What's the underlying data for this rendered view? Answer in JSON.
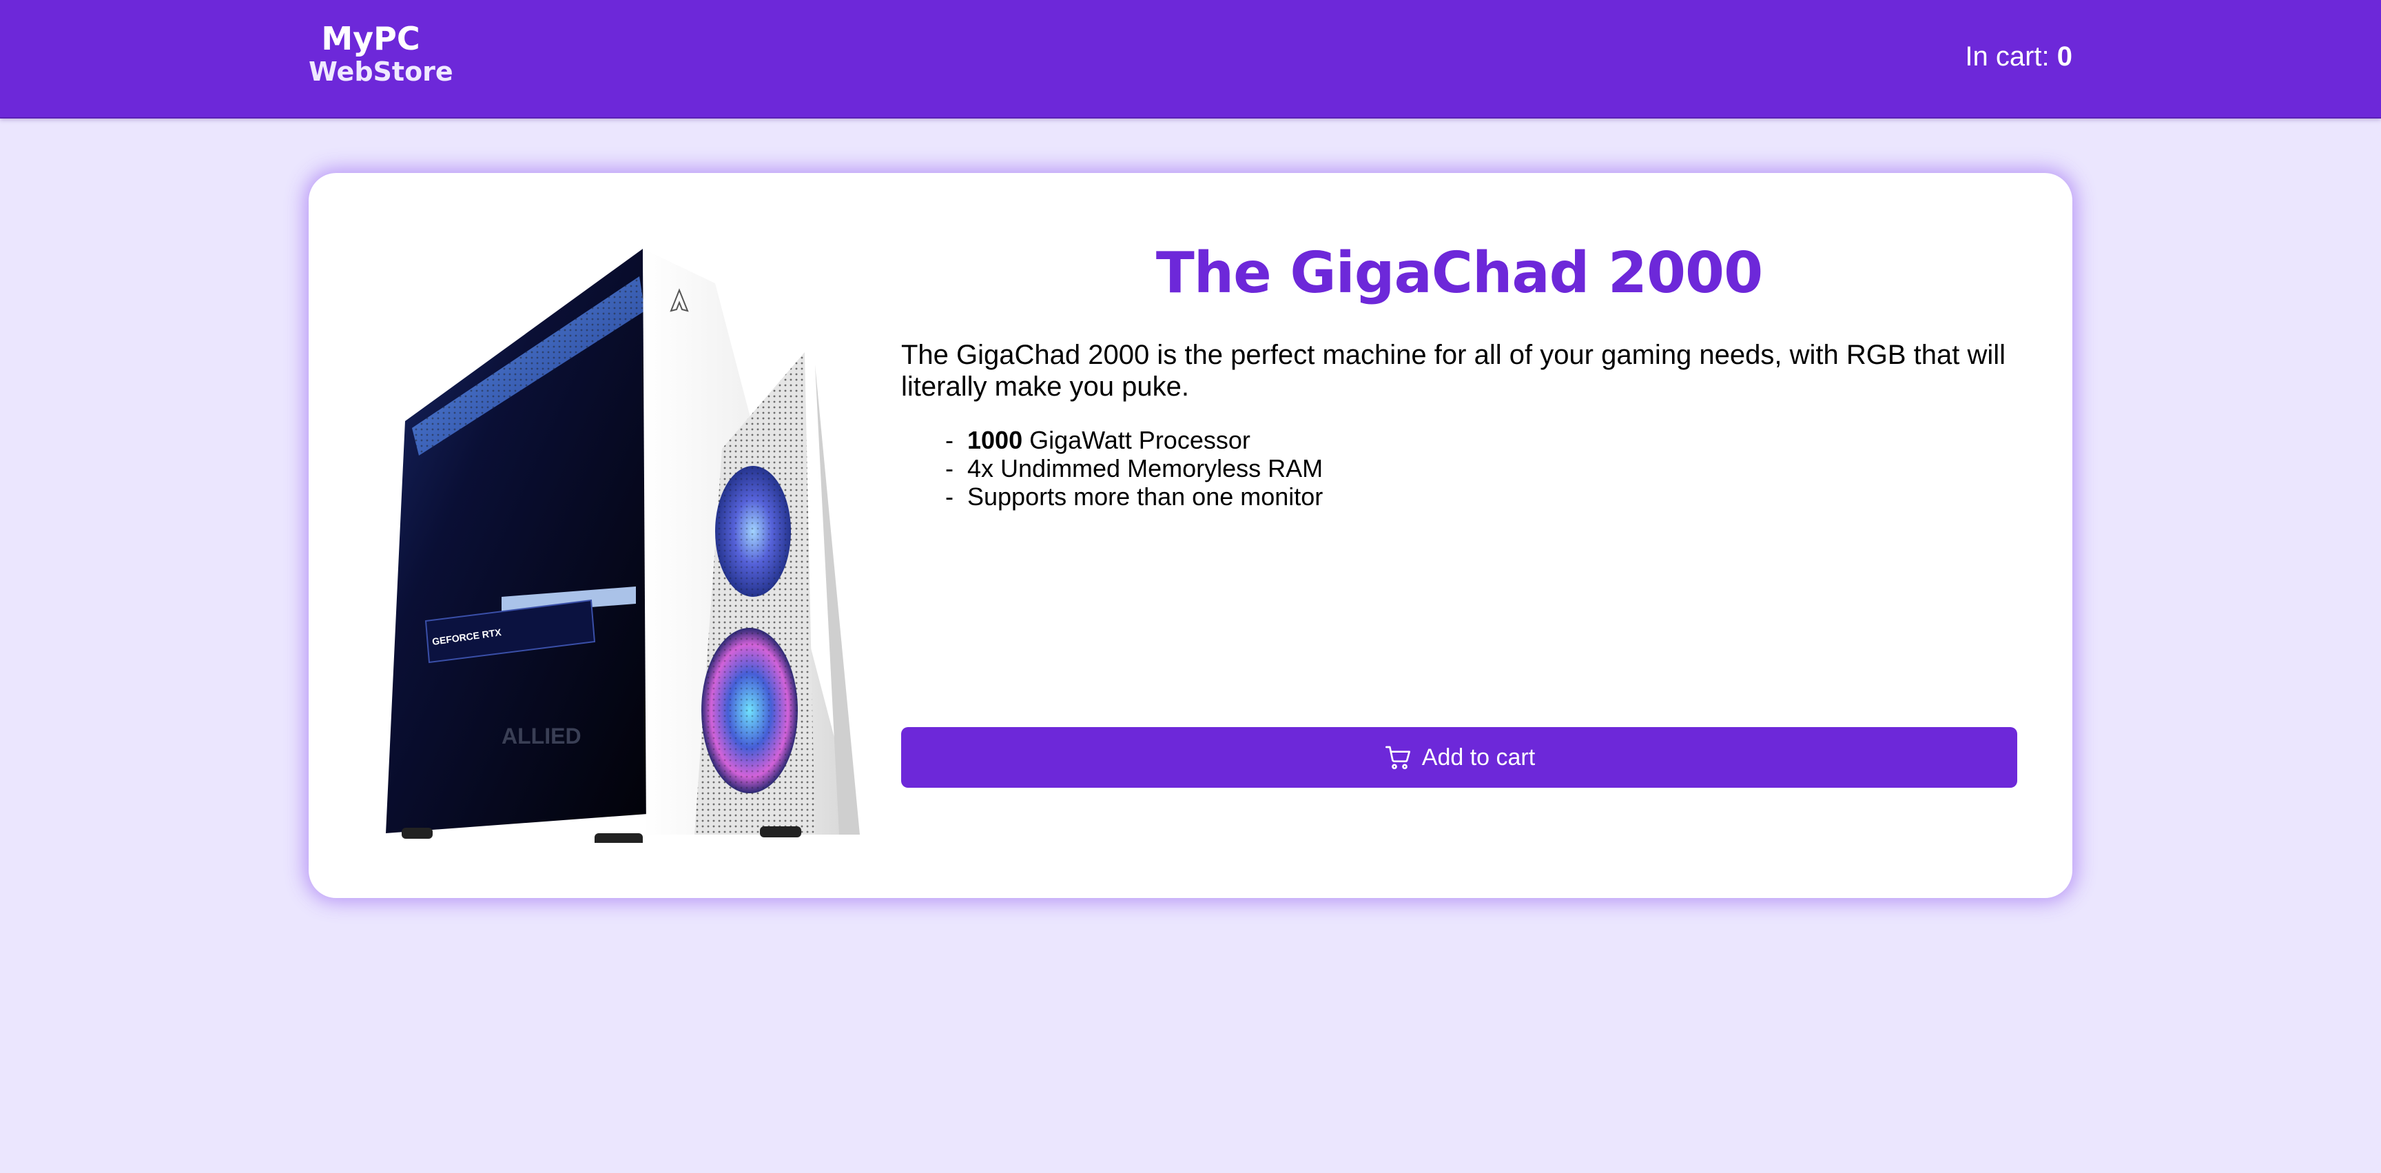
{
  "header": {
    "brand_name": "MyPC",
    "brand_sub": "WebStore",
    "cart_label": "In cart:",
    "cart_count": "0"
  },
  "product": {
    "image_icon": "pc-case-image",
    "title": "The GigaChad 2000",
    "description": "The GigaChad 2000 is the perfect machine for all of your gaming needs, with RGB that will literally make you puke.",
    "specs": [
      {
        "bold": "1000",
        "text": " GigaWatt Processor"
      },
      {
        "bold": "",
        "text": "4x Undimmed Memoryless RAM"
      },
      {
        "bold": "",
        "text": "Supports more than one monitor"
      }
    ],
    "case_logo_text": "ALLIED",
    "gpu_label_text": "GEFORCE RTX",
    "add_to_cart_label": "Add to cart",
    "add_to_cart_icon": "cart-icon"
  },
  "colors": {
    "accent": "#6d28d9",
    "page_background": "#ebe6fe",
    "card_background": "#ffffff"
  }
}
